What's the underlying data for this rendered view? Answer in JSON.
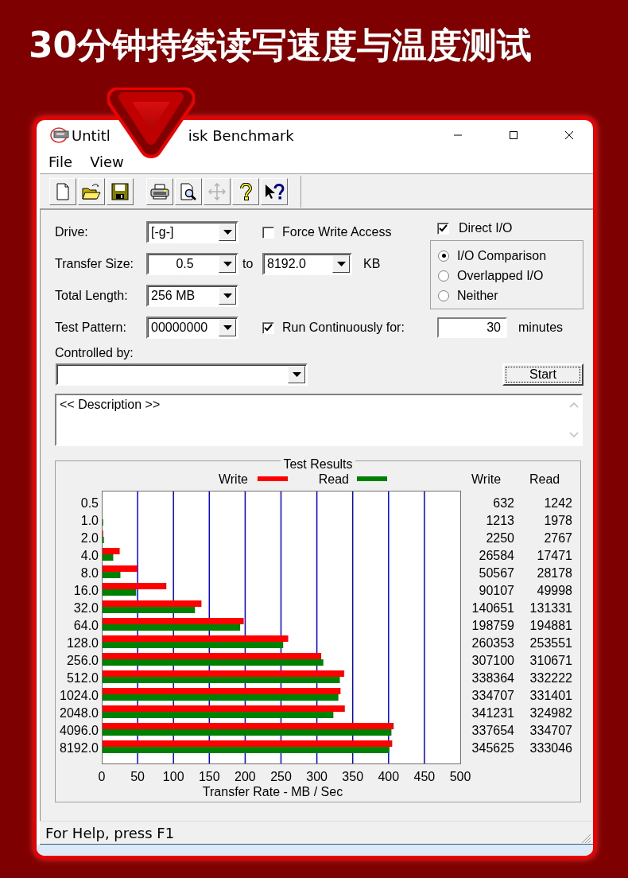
{
  "banner": {
    "title": "30分钟持续读写速度与温度测试"
  },
  "window": {
    "title_parts": [
      "Untitl",
      "isk Benchmark"
    ]
  },
  "menu": [
    "File",
    "View"
  ],
  "toolbar": [
    [
      {
        "kind": "new",
        "disabled": false
      },
      {
        "kind": "open",
        "disabled": false
      },
      {
        "kind": "save",
        "disabled": false
      }
    ],
    [
      {
        "kind": "print",
        "disabled": false
      },
      {
        "kind": "preview",
        "disabled": false
      },
      {
        "kind": "move",
        "disabled": true
      },
      {
        "kind": "help",
        "disabled": false
      },
      {
        "kind": "context_help",
        "disabled": false
      }
    ]
  ],
  "form": {
    "drive": {
      "label": "Drive:",
      "value": "[-g-]"
    },
    "transfer_size": {
      "label": "Transfer Size:",
      "from": "0.5",
      "to_label": "to",
      "to": "8192.0",
      "unit": "KB"
    },
    "total_length": {
      "label": "Total Length:",
      "value": "256 MB"
    },
    "test_pattern": {
      "label": "Test Pattern:",
      "value": "00000000"
    },
    "force_write_access": {
      "label": "Force Write Access",
      "checked": false
    },
    "direct_io": {
      "label": "Direct I/O",
      "checked": true
    },
    "io_mode": [
      {
        "label": "I/O Comparison",
        "selected": true
      },
      {
        "label": "Overlapped I/O",
        "selected": false
      },
      {
        "label": "Neither",
        "selected": false
      }
    ],
    "run_continuously": {
      "label": "Run Continuously for:",
      "checked": true,
      "value": "30",
      "unit": "minutes"
    },
    "controlled_by": {
      "label": "Controlled by:"
    },
    "start_button": "Start",
    "description": "<< Description >>"
  },
  "results": {
    "title": "Test Results",
    "chart_data": {
      "type": "bar",
      "orientation": "horizontal",
      "xlabel": "Transfer Rate - MB / Sec",
      "categories": [
        "0.5",
        "1.0",
        "2.0",
        "4.0",
        "8.0",
        "16.0",
        "32.0",
        "64.0",
        "128.0",
        "256.0",
        "512.0",
        "1024.0",
        "2048.0",
        "4096.0",
        "8192.0"
      ],
      "series": [
        {
          "name": "Write",
          "color": "#ff0000",
          "values": [
            1,
            1,
            2,
            25,
            50,
            90,
            139,
            198,
            260,
            306,
            338,
            333,
            339,
            407,
            405
          ]
        },
        {
          "name": "Read",
          "color": "#008000",
          "values": [
            1,
            2,
            3,
            16,
            26,
            48,
            130,
            193,
            253,
            309,
            332,
            330,
            323,
            404,
            401
          ]
        }
      ],
      "xlim": [
        0,
        500
      ],
      "grid": true,
      "legend": true,
      "xticks": [
        0,
        50,
        100,
        150,
        200,
        250,
        300,
        350,
        400,
        450,
        500
      ]
    },
    "table": {
      "columns": [
        "Write",
        "Read"
      ],
      "rows": [
        [
          "632",
          "1242"
        ],
        [
          "1213",
          "1978"
        ],
        [
          "2250",
          "2767"
        ],
        [
          "26584",
          "17471"
        ],
        [
          "50567",
          "28178"
        ],
        [
          "90107",
          "49998"
        ],
        [
          "140651",
          "131331"
        ],
        [
          "198759",
          "194881"
        ],
        [
          "260353",
          "253551"
        ],
        [
          "307100",
          "310671"
        ],
        [
          "338364",
          "332222"
        ],
        [
          "334707",
          "331401"
        ],
        [
          "341231",
          "324982"
        ],
        [
          "337654",
          "334707"
        ],
        [
          "345625",
          "333046"
        ]
      ]
    }
  },
  "status_bar": "For Help, press F1"
}
